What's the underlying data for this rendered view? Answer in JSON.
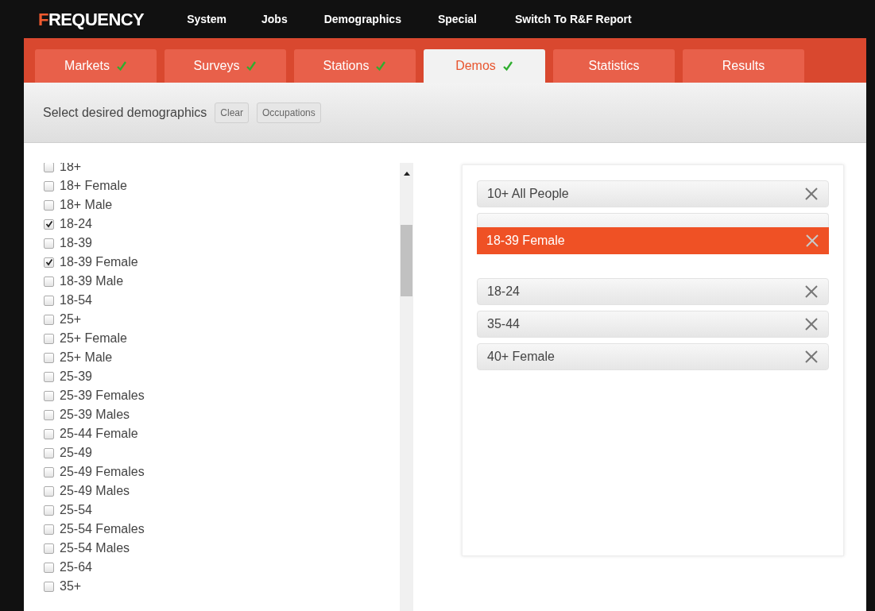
{
  "brand": "FREQUENCY",
  "nav": [
    "System",
    "Jobs",
    "Demographics",
    "Special",
    "Switch To R&F Report"
  ],
  "tabs": [
    {
      "label": "Markets",
      "done": true,
      "selected": false
    },
    {
      "label": "Surveys",
      "done": true,
      "selected": false
    },
    {
      "label": "Stations",
      "done": true,
      "selected": false
    },
    {
      "label": "Demos",
      "done": true,
      "selected": true
    },
    {
      "label": "Statistics",
      "done": false,
      "selected": false
    },
    {
      "label": "Results",
      "done": false,
      "selected": false
    }
  ],
  "toolbar": {
    "prompt": "Select desired demographics",
    "buttons": [
      "Clear",
      "Occupations"
    ]
  },
  "demographics": [
    {
      "label": "18+",
      "checked": false
    },
    {
      "label": "18+ Female",
      "checked": false
    },
    {
      "label": "18+ Male",
      "checked": false
    },
    {
      "label": "18-24",
      "checked": true
    },
    {
      "label": "18-39",
      "checked": false
    },
    {
      "label": "18-39 Female",
      "checked": true
    },
    {
      "label": "18-39 Male",
      "checked": false
    },
    {
      "label": "18-54",
      "checked": false
    },
    {
      "label": "25+",
      "checked": false
    },
    {
      "label": "25+ Female",
      "checked": false
    },
    {
      "label": "25+ Male",
      "checked": false
    },
    {
      "label": "25-39",
      "checked": false
    },
    {
      "label": "25-39 Females",
      "checked": false
    },
    {
      "label": "25-39 Males",
      "checked": false
    },
    {
      "label": "25-44 Female",
      "checked": false
    },
    {
      "label": "25-49",
      "checked": false
    },
    {
      "label": "25-49 Females",
      "checked": false
    },
    {
      "label": "25-49 Males",
      "checked": false
    },
    {
      "label": "25-54",
      "checked": false
    },
    {
      "label": "25-54 Females",
      "checked": false
    },
    {
      "label": "25-54 Males",
      "checked": false
    },
    {
      "label": "25-64",
      "checked": false
    },
    {
      "label": "35+",
      "checked": false
    }
  ],
  "selected_demos": [
    {
      "kind": "item",
      "label": "10+ All People"
    },
    {
      "kind": "covered"
    },
    {
      "kind": "dragging",
      "label": "18-39 Female"
    },
    {
      "kind": "item",
      "label": "18-24"
    },
    {
      "kind": "item",
      "label": "35-44"
    },
    {
      "kind": "item",
      "label": "40+ Female"
    }
  ]
}
